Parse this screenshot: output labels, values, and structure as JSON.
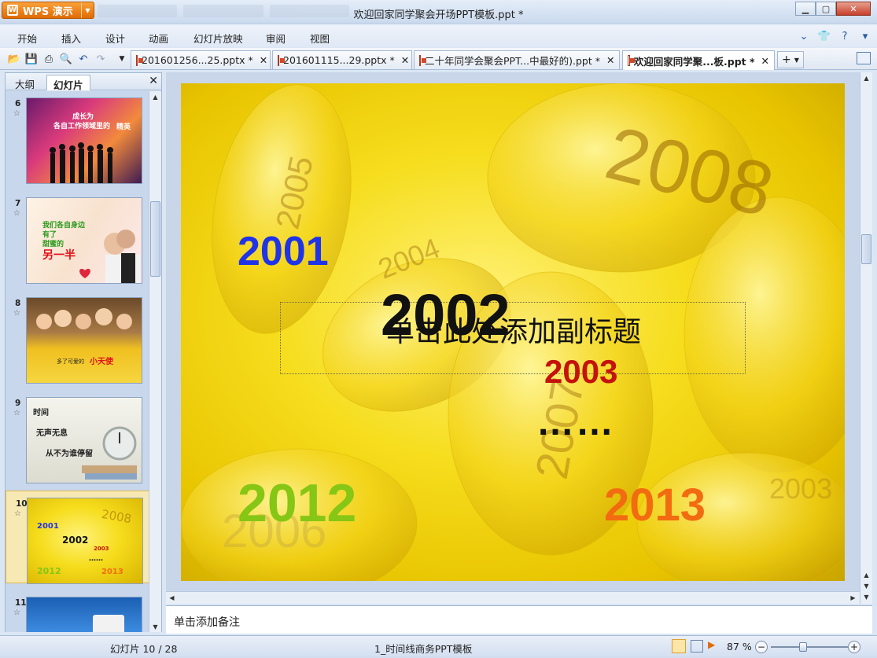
{
  "app": {
    "menu_label": "WPS 演示",
    "window_title": "欢迎回家同学聚会开场PPT模板.ppt *"
  },
  "menu": [
    "开始",
    "插入",
    "设计",
    "动画",
    "幻灯片放映",
    "审阅",
    "视图"
  ],
  "doc_tabs": [
    {
      "label": "201601256...25.pptx *"
    },
    {
      "label": "201601115...29.pptx *"
    },
    {
      "label": "二十年同学会聚会PPT...中最好的).ppt *"
    },
    {
      "label": "欢迎回家同学聚...板.ppt *"
    }
  ],
  "left_pane": {
    "tab_outline": "大纲",
    "tab_slides": "幻灯片",
    "thumbnails": [
      {
        "num": "6",
        "lines": [
          "成长为",
          "各自工作领域里的",
          "精英"
        ]
      },
      {
        "num": "7",
        "lines": [
          "我们各自身边",
          "有了",
          "甜蜜的",
          "另一半"
        ]
      },
      {
        "num": "8",
        "lines": [
          "多了可爱的",
          "小天使"
        ]
      },
      {
        "num": "9",
        "lines": [
          "时间",
          "无声无息",
          "从不为谁停留"
        ]
      },
      {
        "num": "10",
        "lines": [
          "2001",
          "2002",
          "2003",
          "2012",
          "2013",
          "……"
        ]
      },
      {
        "num": "11",
        "lines": []
      }
    ],
    "selected_index": 4
  },
  "slide": {
    "years": {
      "y2001": "2001",
      "y2002": "2002",
      "y2003": "2003",
      "y2012": "2012",
      "y2013": "2013",
      "dots": "……"
    },
    "background_numbers": [
      "2005",
      "2004",
      "2008",
      "2007",
      "2006",
      "2003"
    ],
    "subtitle_placeholder": "单击此处添加副标题",
    "colors": {
      "y2001": "#1f33e8",
      "y2002": "#111111",
      "y2003": "#c4120c",
      "y2012": "#86c614",
      "y2013": "#f36b10"
    }
  },
  "notes_placeholder": "单击添加备注",
  "status": {
    "slide_counter": "幻灯片 10 / 28",
    "template_name": "1_时间线商务PPT模板",
    "zoom": "87 %"
  }
}
